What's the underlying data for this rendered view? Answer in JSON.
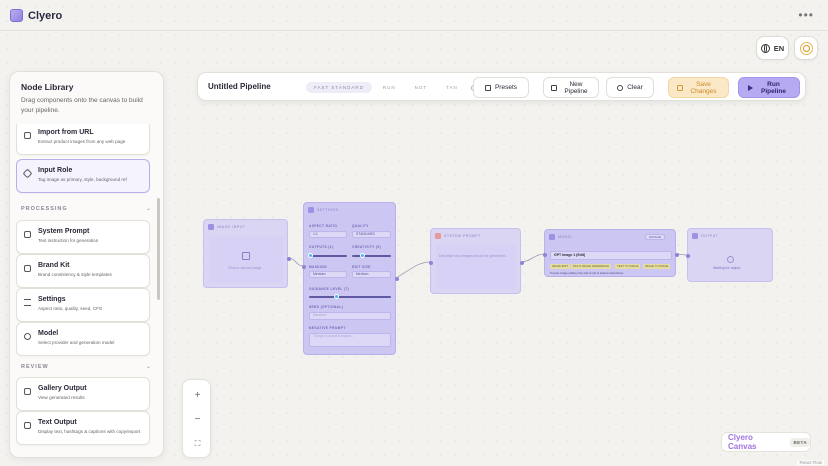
{
  "app": {
    "name": "Clyero"
  },
  "header": {
    "language": "EN"
  },
  "sidebar": {
    "title": "Node Library",
    "subtitle": "Drag components onto the canvas to build your pipeline.",
    "items_top": [
      {
        "name": "Import from URL",
        "desc": "Extract product images from any web page"
      },
      {
        "name": "Input Role",
        "desc": "Tag image as primary, style, background ref"
      }
    ],
    "sections": [
      {
        "label": "PROCESSING",
        "items": [
          {
            "name": "System Prompt",
            "desc": "Text instruction for generation"
          },
          {
            "name": "Brand Kit",
            "desc": "Brand consistency & style templates"
          },
          {
            "name": "Settings",
            "desc": "Aspect ratio, quality, seed, CFG"
          },
          {
            "name": "Model",
            "desc": "Select provider and generation model"
          }
        ]
      },
      {
        "label": "REVIEW",
        "items": [
          {
            "name": "Gallery Output",
            "desc": "View generated results"
          },
          {
            "name": "Text Output",
            "desc": "Display text, hashtags & captions with copy/export"
          }
        ]
      }
    ]
  },
  "toolbar": {
    "pipeline_title": "Untitled Pipeline",
    "modes": [
      "FAST STANDARD",
      "RUN",
      "NOT",
      "TAN"
    ],
    "presets": "Presets",
    "new_pipeline": "New Pipeline",
    "clear": "Clear",
    "save_changes": "Save Changes",
    "run_pipeline": "Run Pipeline"
  },
  "nodes": {
    "image_input": {
      "title": "IMAGE INPUT",
      "hint": "Click to upload image"
    },
    "settings": {
      "title": "SETTINGS",
      "fields": {
        "aspect_ratio": {
          "label": "ASPECT RATIO",
          "value": "1:1"
        },
        "quality": {
          "label": "QUALITY",
          "value": "STANDARD"
        },
        "outputs": {
          "label": "OUTPUTS (1)"
        },
        "creativity": {
          "label": "CREATIVITY (5)"
        },
        "masking": {
          "label": "MASKING",
          "value": "Medium"
        },
        "edit_size": {
          "label": "EDIT SIZE",
          "value": "Medium"
        },
        "guidance": {
          "label": "GUIDANCE LEVEL (7)"
        },
        "seed": {
          "label": "SEED (OPTIONAL)",
          "placeholder": "Random"
        },
        "negative": {
          "label": "NEGATIVE PROMPT",
          "placeholder": "Things to avoid in output..."
        }
      }
    },
    "system_prompt": {
      "title": "SYSTEM PROMPT",
      "hint": "Describe how images should be generated..."
    },
    "model": {
      "title": "MODEL",
      "badge": "GOOGLE",
      "selected": "GPT Image 1 (Edit)",
      "chips": [
        "IMAGE EDIT",
        "MULTI-IMAGE REFERENCE",
        "TEXT TO IMAGE",
        "IMAGE TO IMAGE"
      ],
      "desc": "Top-tier image editing, fine with 4 refs & shared instructions"
    },
    "output": {
      "title": "OUTPUT",
      "hint": "Waiting for output"
    }
  },
  "zoom": {
    "in": "+",
    "out": "−",
    "fit": "⛶"
  },
  "brand_badge": {
    "name": "Clyero Canvas",
    "tag": "BETA"
  },
  "attribution": "React Flow",
  "colors": {
    "accent": "#b6aaf2",
    "node": "#cbc6f2",
    "save": "#fbe8c6",
    "brand": "#a274e0"
  }
}
